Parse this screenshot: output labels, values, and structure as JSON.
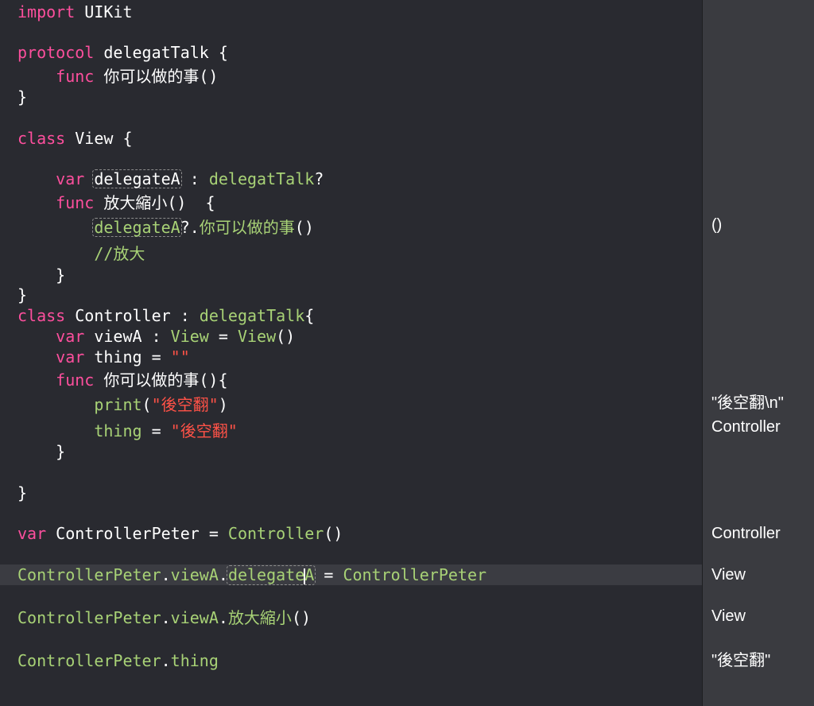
{
  "editor": {
    "lines": [
      {
        "parts": [
          {
            "t": "import",
            "c": "pink"
          },
          {
            "t": " UIKit",
            "c": "bright"
          }
        ]
      },
      {
        "parts": [
          {
            "t": "protocol",
            "c": "pink"
          },
          {
            "t": " delegatTalk {",
            "c": "bright"
          }
        ]
      },
      {
        "parts": [
          {
            "t": "    func",
            "c": "pink"
          },
          {
            "t": " 你可以做的事()",
            "c": "bright"
          }
        ]
      },
      {
        "parts": [
          {
            "t": "}",
            "c": "bright"
          }
        ]
      },
      {
        "parts": [
          {
            "t": "class",
            "c": "pink"
          },
          {
            "t": " View {",
            "c": "bright"
          }
        ]
      },
      {
        "parts": [
          {
            "t": "    var",
            "c": "pink"
          },
          {
            "t": " ",
            "c": "bright"
          },
          {
            "t": "delegateA",
            "c": "bright",
            "ph": true
          },
          {
            "t": " : ",
            "c": "bright"
          },
          {
            "t": "delegatTalk",
            "c": "lime"
          },
          {
            "t": "?",
            "c": "bright"
          }
        ]
      },
      {
        "parts": [
          {
            "t": "    func",
            "c": "pink"
          },
          {
            "t": " 放大縮小()  {",
            "c": "bright"
          }
        ]
      },
      {
        "parts": [
          {
            "t": "        ",
            "c": "bright"
          },
          {
            "t": "delegateA",
            "c": "lime",
            "ph": true
          },
          {
            "t": "?.",
            "c": "bright"
          },
          {
            "t": "你可以做的事",
            "c": "lime"
          },
          {
            "t": "()",
            "c": "bright"
          }
        ]
      },
      {
        "parts": [
          {
            "t": "        //放大",
            "c": "lime"
          }
        ]
      },
      {
        "parts": [
          {
            "t": "    }",
            "c": "bright"
          }
        ]
      },
      {
        "parts": [
          {
            "t": "}",
            "c": "bright"
          }
        ]
      },
      {
        "parts": [
          {
            "t": "class",
            "c": "pink"
          },
          {
            "t": " Controller : ",
            "c": "bright"
          },
          {
            "t": "delegatTalk",
            "c": "lime"
          },
          {
            "t": "{",
            "c": "bright"
          }
        ]
      },
      {
        "parts": [
          {
            "t": "    var",
            "c": "pink"
          },
          {
            "t": " viewA : ",
            "c": "bright"
          },
          {
            "t": "View",
            "c": "lime"
          },
          {
            "t": " = ",
            "c": "bright"
          },
          {
            "t": "View",
            "c": "lime"
          },
          {
            "t": "()",
            "c": "bright"
          }
        ]
      },
      {
        "parts": [
          {
            "t": "    var",
            "c": "pink"
          },
          {
            "t": " thing = ",
            "c": "bright"
          },
          {
            "t": "\"\"",
            "c": "red"
          }
        ]
      },
      {
        "parts": [
          {
            "t": "    func",
            "c": "pink"
          },
          {
            "t": " 你可以做的事(){",
            "c": "bright"
          }
        ]
      },
      {
        "parts": [
          {
            "t": "        ",
            "c": "bright"
          },
          {
            "t": "print",
            "c": "lime"
          },
          {
            "t": "(",
            "c": "bright"
          },
          {
            "t": "\"後空翻\"",
            "c": "red"
          },
          {
            "t": ")",
            "c": "bright"
          }
        ]
      },
      {
        "parts": [
          {
            "t": "        ",
            "c": "bright"
          },
          {
            "t": "thing",
            "c": "lime"
          },
          {
            "t": " = ",
            "c": "bright"
          },
          {
            "t": "\"後空翻\"",
            "c": "red"
          }
        ]
      },
      {
        "parts": [
          {
            "t": "    }",
            "c": "bright"
          }
        ]
      },
      {
        "parts": [
          {
            "t": "}",
            "c": "bright"
          }
        ]
      },
      {
        "parts": [
          {
            "t": "var",
            "c": "pink"
          },
          {
            "t": " ControllerPeter = ",
            "c": "bright"
          },
          {
            "t": "Controller",
            "c": "lime"
          },
          {
            "t": "()",
            "c": "bright"
          }
        ]
      },
      {
        "parts": [
          {
            "t": "ControllerPeter",
            "c": "lime"
          },
          {
            "t": ".",
            "c": "bright"
          },
          {
            "t": "viewA",
            "c": "lime"
          },
          {
            "t": ".",
            "c": "bright"
          },
          {
            "t": "delegate",
            "c": "lime",
            "ph": true,
            "cursor": true,
            "tail": "A"
          },
          {
            "t": " = ",
            "c": "bright"
          },
          {
            "t": "ControllerPeter",
            "c": "lime"
          }
        ],
        "current": true
      },
      {
        "parts": [
          {
            "t": "ControllerPeter",
            "c": "lime"
          },
          {
            "t": ".",
            "c": "bright"
          },
          {
            "t": "viewA",
            "c": "lime"
          },
          {
            "t": ".",
            "c": "bright"
          },
          {
            "t": "放大縮小",
            "c": "lime"
          },
          {
            "t": "()",
            "c": "bright"
          }
        ]
      },
      {
        "parts": [
          {
            "t": "ControllerPeter",
            "c": "lime"
          },
          {
            "t": ".",
            "c": "bright"
          },
          {
            "t": "thing",
            "c": "lime"
          }
        ]
      }
    ]
  },
  "results": {
    "items": [
      "()",
      "\"後空翻\\n\"",
      "Controller",
      "Controller",
      "View",
      "View",
      "\"後空翻\""
    ]
  }
}
